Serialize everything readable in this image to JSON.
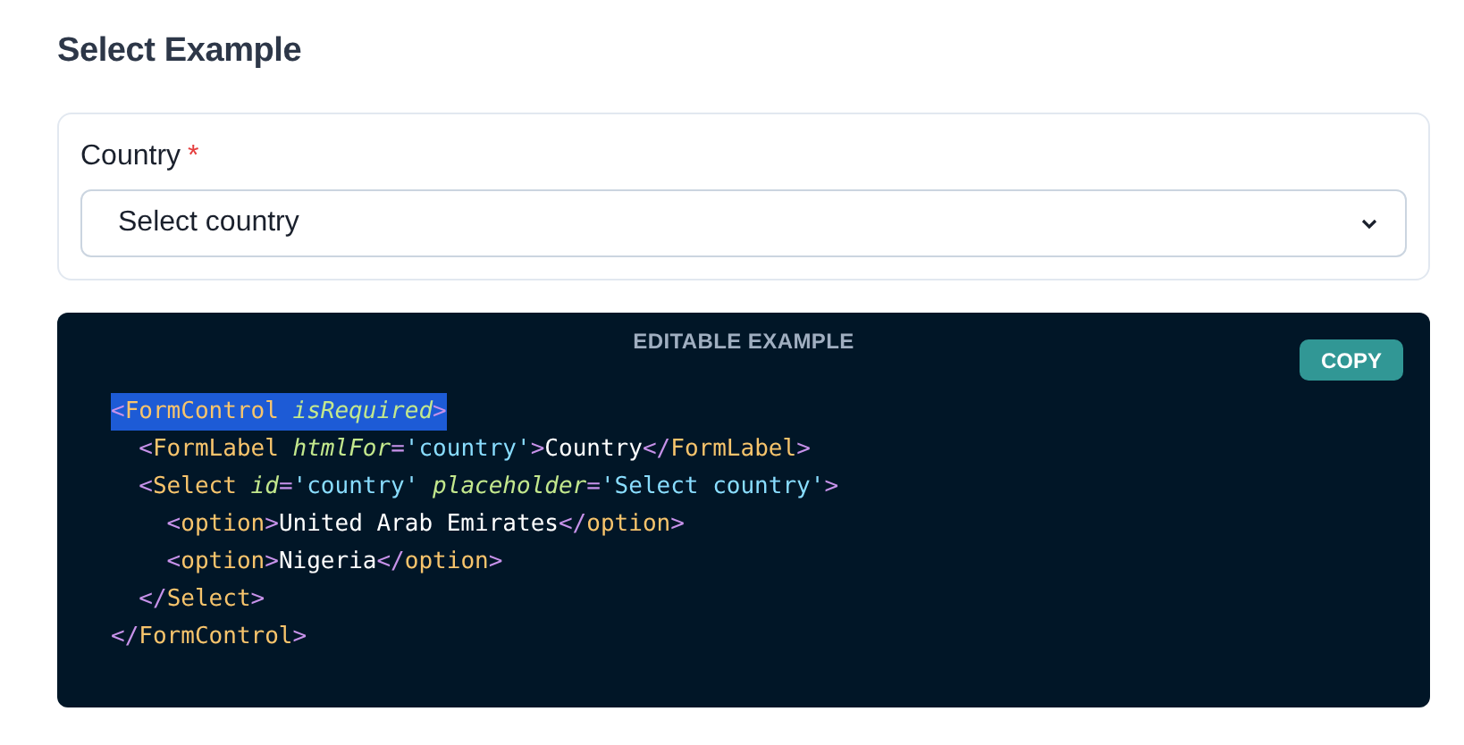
{
  "title": "Select Example",
  "form": {
    "label": "Country",
    "required_mark": "*",
    "select": {
      "placeholder": "Select country"
    }
  },
  "code_example": {
    "header": "EDITABLE EXAMPLE",
    "copy_button": "COPY",
    "lines": [
      {
        "selected": true,
        "tokens": [
          {
            "kind": "punct",
            "text": "<"
          },
          {
            "kind": "tag",
            "text": "FormControl"
          },
          {
            "kind": "attr",
            "text": " isRequired"
          },
          {
            "kind": "punct",
            "text": ">"
          }
        ]
      },
      {
        "selected": false,
        "tokens": [
          {
            "kind": "punct",
            "text": "  <"
          },
          {
            "kind": "tag",
            "text": "FormLabel"
          },
          {
            "kind": "attr",
            "text": " htmlFor"
          },
          {
            "kind": "punct",
            "text": "="
          },
          {
            "kind": "str",
            "text": "'country'"
          },
          {
            "kind": "punct",
            "text": ">"
          },
          {
            "kind": "text",
            "text": "Country"
          },
          {
            "kind": "punct",
            "text": "</"
          },
          {
            "kind": "tag",
            "text": "FormLabel"
          },
          {
            "kind": "punct",
            "text": ">"
          }
        ]
      },
      {
        "selected": false,
        "tokens": [
          {
            "kind": "punct",
            "text": "  <"
          },
          {
            "kind": "tag",
            "text": "Select"
          },
          {
            "kind": "attr",
            "text": " id"
          },
          {
            "kind": "punct",
            "text": "="
          },
          {
            "kind": "str",
            "text": "'country'"
          },
          {
            "kind": "attr",
            "text": " placeholder"
          },
          {
            "kind": "punct",
            "text": "="
          },
          {
            "kind": "str",
            "text": "'Select country'"
          },
          {
            "kind": "punct",
            "text": ">"
          }
        ]
      },
      {
        "selected": false,
        "tokens": [
          {
            "kind": "punct",
            "text": "    <"
          },
          {
            "kind": "tag",
            "text": "option"
          },
          {
            "kind": "punct",
            "text": ">"
          },
          {
            "kind": "text",
            "text": "United Arab Emirates"
          },
          {
            "kind": "punct",
            "text": "</"
          },
          {
            "kind": "tag",
            "text": "option"
          },
          {
            "kind": "punct",
            "text": ">"
          }
        ]
      },
      {
        "selected": false,
        "tokens": [
          {
            "kind": "punct",
            "text": "    <"
          },
          {
            "kind": "tag",
            "text": "option"
          },
          {
            "kind": "punct",
            "text": ">"
          },
          {
            "kind": "text",
            "text": "Nigeria"
          },
          {
            "kind": "punct",
            "text": "</"
          },
          {
            "kind": "tag",
            "text": "option"
          },
          {
            "kind": "punct",
            "text": ">"
          }
        ]
      },
      {
        "selected": false,
        "tokens": [
          {
            "kind": "punct",
            "text": "  </"
          },
          {
            "kind": "tag",
            "text": "Select"
          },
          {
            "kind": "punct",
            "text": ">"
          }
        ]
      },
      {
        "selected": false,
        "tokens": [
          {
            "kind": "punct",
            "text": "</"
          },
          {
            "kind": "tag",
            "text": "FormControl"
          },
          {
            "kind": "punct",
            "text": ">"
          }
        ]
      }
    ]
  }
}
